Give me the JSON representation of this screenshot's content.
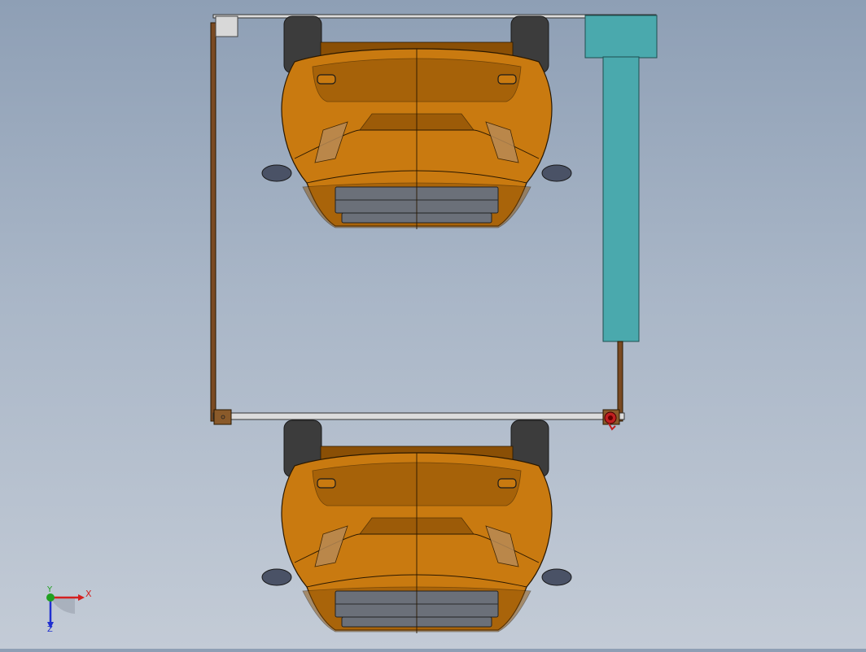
{
  "viewport": {
    "background_top": "#8e9fb5",
    "background_bottom": "#c3cbd6"
  },
  "colors": {
    "car_body": "#c97a10",
    "car_body_dark": "#8a4f05",
    "car_outline": "#2a1800",
    "tire": "#3c3c3c",
    "grille": "#6b7079",
    "mirror": "#4a5266",
    "frame_post": "#7a4a22",
    "rail": "#dcdcdc",
    "cylinder": "#4aa9ad",
    "marker": "#c02020"
  },
  "triad": {
    "x_label": "X",
    "y_label": "Y",
    "z_label": "Z",
    "x_color": "#d42020",
    "y_color": "#20a020",
    "z_color": "#2030d0"
  },
  "scene": {
    "icons": [
      "axis-triad-icon"
    ],
    "objects": [
      "car-upper",
      "car-lower",
      "frame-left-post",
      "frame-right-post",
      "top-rail",
      "bottom-rail",
      "hydraulic-cylinder"
    ]
  }
}
